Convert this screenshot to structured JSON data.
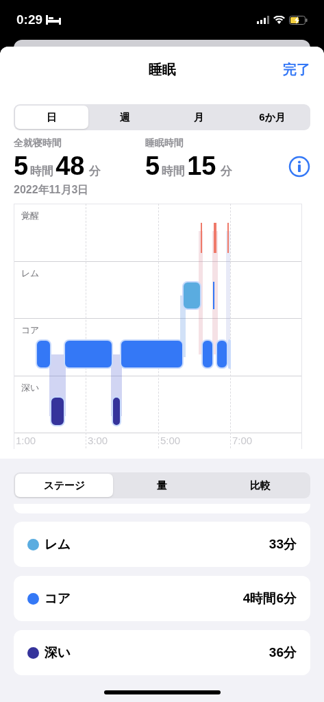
{
  "status_bar": {
    "time": "0:29"
  },
  "nav": {
    "title": "睡眠",
    "done": "完了"
  },
  "period_tabs": [
    {
      "label": "日",
      "selected": true
    },
    {
      "label": "週",
      "selected": false
    },
    {
      "label": "月",
      "selected": false
    },
    {
      "label": "6か月",
      "selected": false
    }
  ],
  "stats": [
    {
      "label": "全就寝時間",
      "hours": "5",
      "hours_unit": "時間",
      "minutes": "48",
      "minutes_unit": "分"
    },
    {
      "label": "睡眠時間",
      "hours": "5",
      "hours_unit": "時間",
      "minutes": "15",
      "minutes_unit": "分"
    }
  ],
  "date": "2022年11月3日",
  "chart": {
    "stages": [
      "覚醒",
      "レム",
      "コア",
      "深い"
    ],
    "time_labels": [
      "1:00",
      "3:00",
      "5:00",
      "7:00"
    ]
  },
  "view_tabs": [
    {
      "label": "ステージ",
      "selected": true
    },
    {
      "label": "量",
      "selected": false
    },
    {
      "label": "比較",
      "selected": false
    }
  ],
  "stage_list": [
    {
      "name": "レム",
      "value": "33分",
      "color": "#5aace0"
    },
    {
      "name": "コア",
      "value": "4時間6分",
      "color": "#3478f6"
    },
    {
      "name": "深い",
      "value": "36分",
      "color": "#35339b"
    }
  ]
}
